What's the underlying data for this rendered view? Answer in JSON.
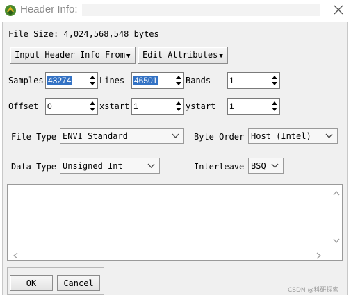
{
  "window": {
    "title": "Header Info:",
    "icon": "envi-logo-icon",
    "close_icon": "close-icon"
  },
  "file_size": "File Size: 4,024,568,548 bytes",
  "menus": {
    "input_header": "Input Header Info From",
    "edit_attributes": "Edit Attributes"
  },
  "dims": {
    "samples_label": "Samples",
    "samples_value": "43274",
    "lines_label": "Lines",
    "lines_value": "46501",
    "bands_label": "Bands",
    "bands_value": "1"
  },
  "offsets": {
    "offset_label": "Offset",
    "offset_value": "0",
    "xstart_label": "xstart",
    "xstart_value": "1",
    "ystart_label": "ystart",
    "ystart_value": "1"
  },
  "file_type": {
    "label": "File Type",
    "value": "ENVI Standard"
  },
  "byte_order": {
    "label": "Byte Order",
    "value": "Host (Intel)"
  },
  "data_type": {
    "label": "Data Type",
    "value": "Unsigned Int"
  },
  "interleave": {
    "label": "Interleave",
    "value": "BSQ"
  },
  "buttons": {
    "ok": "OK",
    "cancel": "Cancel"
  },
  "watermark": "CSDN @科研探索",
  "colors": {
    "selection": "#3372c4",
    "dialog_bg": "#f0f0f0",
    "logo_green": "#4a8a2c",
    "logo_gold": "#e0b020"
  }
}
